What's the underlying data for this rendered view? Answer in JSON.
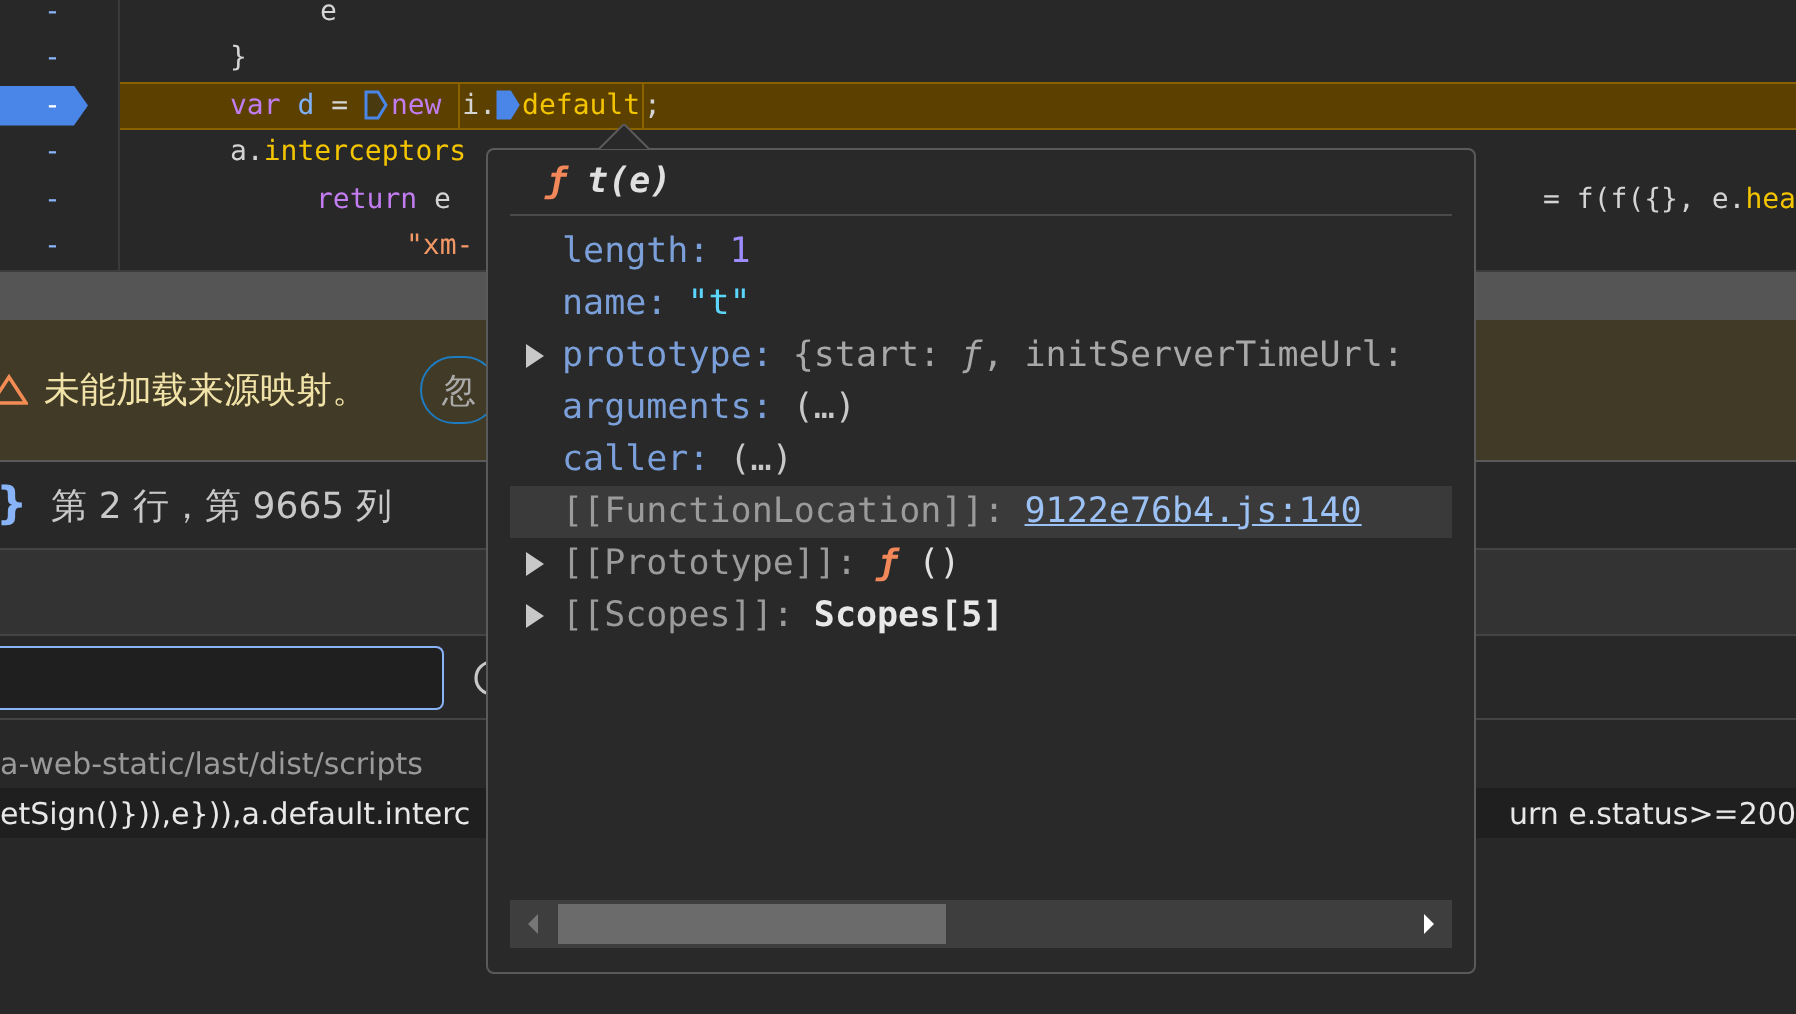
{
  "editor": {
    "lines": [
      {
        "marker": "-",
        "breakpoint": false,
        "highlighted": false,
        "tokens": [
          {
            "kind": "plain",
            "text": "e"
          }
        ]
      },
      {
        "marker": "-",
        "breakpoint": false,
        "highlighted": false,
        "tokens": [
          {
            "kind": "plain",
            "text": "}"
          }
        ]
      },
      {
        "marker": "-",
        "breakpoint": true,
        "highlighted": true,
        "tokens": [
          {
            "kind": "keyword",
            "text": "var "
          },
          {
            "kind": "variable",
            "text": "d"
          },
          {
            "kind": "plain",
            "text": " = "
          },
          {
            "kind": "pause",
            "active": false
          },
          {
            "kind": "keyword",
            "text": "new "
          },
          {
            "kind": "evaluated",
            "tokens": [
              {
                "kind": "plain",
                "text": "i."
              },
              {
                "kind": "pause",
                "active": true
              },
              {
                "kind": "property",
                "text": "default"
              }
            ]
          },
          {
            "kind": "plain",
            "text": ";"
          }
        ]
      },
      {
        "marker": "-",
        "breakpoint": false,
        "highlighted": false,
        "tokens": [
          {
            "kind": "plain",
            "text": "a."
          },
          {
            "kind": "property",
            "text": "interceptors"
          }
        ]
      },
      {
        "marker": "-",
        "breakpoint": false,
        "highlighted": false,
        "tokens": [
          {
            "kind": "keyword",
            "text": "return "
          },
          {
            "kind": "plain",
            "text": "e"
          }
        ],
        "trailing": [
          {
            "kind": "plain",
            "text": "= f(f({}, e."
          },
          {
            "kind": "property",
            "text": "hea"
          }
        ]
      },
      {
        "marker": "-",
        "breakpoint": false,
        "highlighted": false,
        "tokens": [
          {
            "kind": "string",
            "text": "\"xm-"
          }
        ]
      }
    ]
  },
  "warning": {
    "message": "未能加载来源映射。",
    "button": "忽"
  },
  "status": {
    "brace": "}",
    "position": "第 2 行，第 9665 列"
  },
  "results": {
    "path": "a-web-static/last/dist/scripts",
    "match_left": "etSign()})),e})),a.default.interc",
    "match_right": "urn e.status>=200"
  },
  "popover": {
    "title": {
      "symbol": "ƒ",
      "signature": "t(e)"
    },
    "rows": [
      {
        "kind": "number",
        "key": "length:",
        "value": "1",
        "expandable": false,
        "selected": false
      },
      {
        "kind": "string",
        "key": "name:",
        "value": "\"t\"",
        "expandable": false,
        "selected": false
      },
      {
        "kind": "preview",
        "key": "prototype:",
        "value": "{start: *ƒ*, initServerTimeUrl:",
        "expandable": true,
        "selected": false
      },
      {
        "kind": "getter",
        "key": "arguments:",
        "value": "(…)",
        "expandable": false,
        "selected": false
      },
      {
        "kind": "getter",
        "key": "caller:",
        "value": "(…)",
        "expandable": false,
        "selected": false
      },
      {
        "kind": "link",
        "key": "[[FunctionLocation]]:",
        "value": "9122e76b4.js:140",
        "expandable": false,
        "selected": true
      },
      {
        "kind": "function",
        "key": "[[Prototype]]:",
        "symbol": "ƒ",
        "value": "()",
        "expandable": true,
        "selected": false
      },
      {
        "kind": "object",
        "key": "[[Scopes]]:",
        "value": "Scopes[5]",
        "expandable": true,
        "selected": false
      }
    ]
  }
}
